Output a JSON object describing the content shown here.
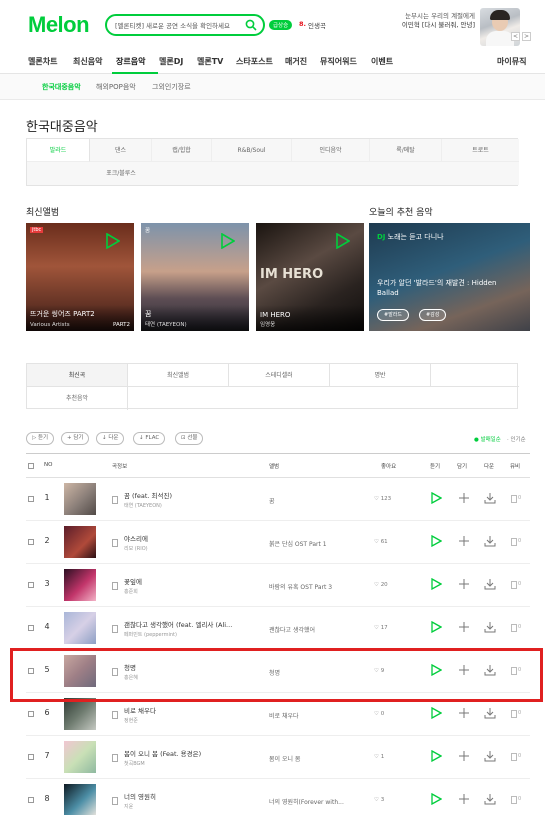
{
  "header": {
    "logo": "Melon",
    "search_text": "[멜론티켓] 새로운 공연 소식을 확인하세요",
    "rank_badge": "급상승",
    "rank_num": "8.",
    "rank_text": "인생곡",
    "promo_line1": "눈부시는 우리의 계절에게",
    "promo_line2": "이민혁 [다시 불러줘, 안녕]",
    "prev": "<",
    "next": ">"
  },
  "gnb": [
    "멜론차트",
    "최신음악",
    "장르음악",
    "멜론DJ",
    "멜론TV",
    "스타포스트",
    "매거진",
    "뮤직어워드",
    "이벤트",
    "마이뮤직"
  ],
  "subnav": [
    "한국대중음악",
    "해외POP음악",
    "그외인기장르"
  ],
  "page_title": "한국대중음악",
  "genres": [
    "발라드",
    "댄스",
    "랩/힙합",
    "R&B/Soul",
    "인디음악",
    "록/메탈",
    "트로트",
    "포크/블루스"
  ],
  "sections": {
    "latest": "최신앨범",
    "today": "오늘의 추천 음악"
  },
  "albums": [
    {
      "title": "뜨거운 씽어즈 PART2",
      "artist": "Various Artists",
      "stamp": "jtbc",
      "mini": "PART2"
    },
    {
      "title": "꿈",
      "artist": "태연 (TAEYEON)",
      "mini": "꿈"
    },
    {
      "title": "IM HERO",
      "artist": "임영웅",
      "mini": "IM HERO"
    }
  ],
  "recommend": {
    "dj_label": "DJ",
    "dj_text": "노래는 듣고 다니나",
    "title": "우리가 알던 '발라드'의 재발견 : Hidden Ballad",
    "tags": [
      "#발라드",
      "#감성"
    ]
  },
  "tabs": [
    "최신곡",
    "최신앨범",
    "스테디셀러",
    "명반",
    "추천음악"
  ],
  "toolbar": {
    "buttons": [
      "듣기",
      "담기",
      "다운",
      "FLAC",
      "선물"
    ],
    "sort": [
      "발매일순",
      "인기순"
    ]
  },
  "table_headers": {
    "no": "NO",
    "song": "곡정보",
    "album": "앨범",
    "like": "좋아요",
    "play": "듣기",
    "add": "담기",
    "down": "다운",
    "mv": "뮤비"
  },
  "rows": [
    {
      "rank": "1",
      "title": "꿈 (feat. 최석진)",
      "artist": "태연 (TAEYEON)",
      "album": "꿈",
      "likes": "123",
      "thumb": "linear-gradient(135deg,#cdb6a5,#8a7e78 55%,#514a47)"
    },
    {
      "rank": "2",
      "title": "야스리에",
      "artist": "리모 (RIO)",
      "album": "붉은 단심 OST Part 1",
      "likes": "61",
      "thumb": "linear-gradient(135deg,#5b1d2a,#b04a3a 60%,#2b1014)"
    },
    {
      "rank": "3",
      "title": "꽃잎에",
      "artist": "홍준희",
      "album": "바람의 유혹 OST Part 3",
      "likes": "20",
      "thumb": "linear-gradient(135deg,#2b0f22,#c2356a 55%,#f3b3c7)"
    },
    {
      "rank": "4",
      "title": "괜찮다고 생각했어 (feat. 엘리사 (Ali...",
      "artist": "페퍼민트 (peppermint)",
      "album": "괜찮다고 생각했어",
      "likes": "17",
      "thumb": "linear-gradient(135deg,#a9b6d8,#d7d0e6 50%,#8d9fc4)"
    },
    {
      "rank": "5",
      "title": "청명",
      "artist": "홍은혜",
      "album": "청명",
      "likes": "9",
      "thumb": "linear-gradient(135deg,#c8a7a0,#9e7f86 50%,#6f6a7c)"
    },
    {
      "rank": "6",
      "title": "비로 채우다",
      "artist": "정현준",
      "album": "비로 채우다",
      "likes": "0",
      "thumb": "linear-gradient(135deg,#2f3a33,#6e7b6f 50%,#c5c9c2)"
    },
    {
      "rank": "7",
      "title": "봄이 오니 봄 (Feat. 용경은)",
      "artist": "첫곡BGM",
      "album": "봄이 오니 봄",
      "likes": "1",
      "thumb": "linear-gradient(135deg,#f1c6d2,#c9e0b6 50%,#8fb9a0)"
    },
    {
      "rank": "8",
      "title": "너의 영원히",
      "artist": "지윤",
      "album": "너의 영원히(Forever with...",
      "likes": "3",
      "thumb": "linear-gradient(135deg,#0e1a22,#4d8fa7 55%,#e8e4dd)"
    }
  ],
  "colors": {
    "brand": "#00cd3c",
    "highlight": "#e02020"
  }
}
